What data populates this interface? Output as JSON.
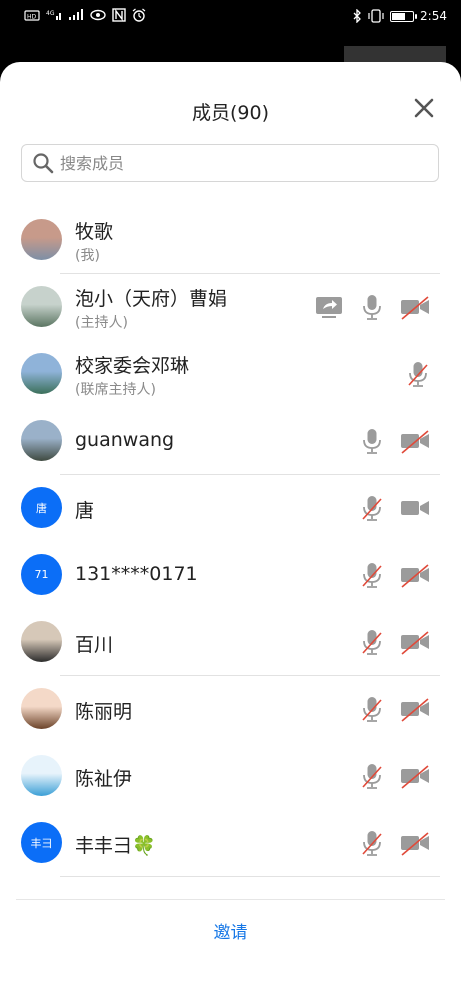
{
  "status_bar": {
    "left_icons": [
      "nfc-icon",
      "signal-4g-icon",
      "signal-bars-icon",
      "wifi-icon",
      "eye-icon",
      "n-icon",
      "alarm-icon"
    ],
    "right_icons": [
      "bluetooth-icon",
      "vibrate-icon",
      "battery-icon"
    ],
    "time": "2:54"
  },
  "header": {
    "title": "成员(90)"
  },
  "search": {
    "placeholder": "搜索成员"
  },
  "members": [
    {
      "name": "牧歌",
      "role": "(我)",
      "avatar": {
        "type": "photo",
        "colors": [
          "#c79a8a",
          "#7d8fa6"
        ]
      },
      "share": false,
      "mic": "none",
      "cam": "none"
    },
    {
      "name": "泡小（天府）曹娟",
      "role": "(主持人)",
      "avatar": {
        "type": "photo",
        "colors": [
          "#c7d2cc",
          "#5b7562"
        ]
      },
      "share": true,
      "mic": "on",
      "cam": "off"
    },
    {
      "name": "校家委会邓琳",
      "role": "(联席主持人)",
      "avatar": {
        "type": "photo",
        "colors": [
          "#8fb3d9",
          "#3b6f5a"
        ]
      },
      "share": false,
      "mic": "off",
      "cam": "none"
    },
    {
      "name": "guanwang",
      "role": "",
      "avatar": {
        "type": "photo",
        "colors": [
          "#9ab1c9",
          "#3f4a40"
        ]
      },
      "share": false,
      "mic": "on",
      "cam": "off"
    },
    {
      "name": "唐",
      "role": "",
      "avatar": {
        "type": "text",
        "text": "唐"
      },
      "share": false,
      "mic": "off",
      "cam": "on"
    },
    {
      "name": "131****0171",
      "role": "",
      "avatar": {
        "type": "text",
        "text": "71"
      },
      "share": false,
      "mic": "off",
      "cam": "off"
    },
    {
      "name": "百川",
      "role": "",
      "avatar": {
        "type": "photo",
        "colors": [
          "#d6c8b8",
          "#2b2b2b"
        ]
      },
      "share": false,
      "mic": "off",
      "cam": "off"
    },
    {
      "name": "陈丽明",
      "role": "",
      "avatar": {
        "type": "photo",
        "colors": [
          "#f4d9c8",
          "#6b4228"
        ]
      },
      "share": false,
      "mic": "off",
      "cam": "off"
    },
    {
      "name": "陈祉伊",
      "role": "",
      "avatar": {
        "type": "photo",
        "colors": [
          "#e7f3fb",
          "#3b9fd6"
        ]
      },
      "share": false,
      "mic": "off",
      "cam": "off"
    },
    {
      "name": "丰丰彐🍀",
      "role": "",
      "avatar": {
        "type": "text",
        "text": "丰彐"
      },
      "share": false,
      "mic": "off",
      "cam": "off"
    }
  ],
  "footer": {
    "invite_label": "邀请"
  },
  "colors": {
    "accent": "#1677e6",
    "avatar_blue": "#0b6ef7",
    "icon_gray": "#9b9b9b",
    "muted_slash": "#e04a3a"
  }
}
